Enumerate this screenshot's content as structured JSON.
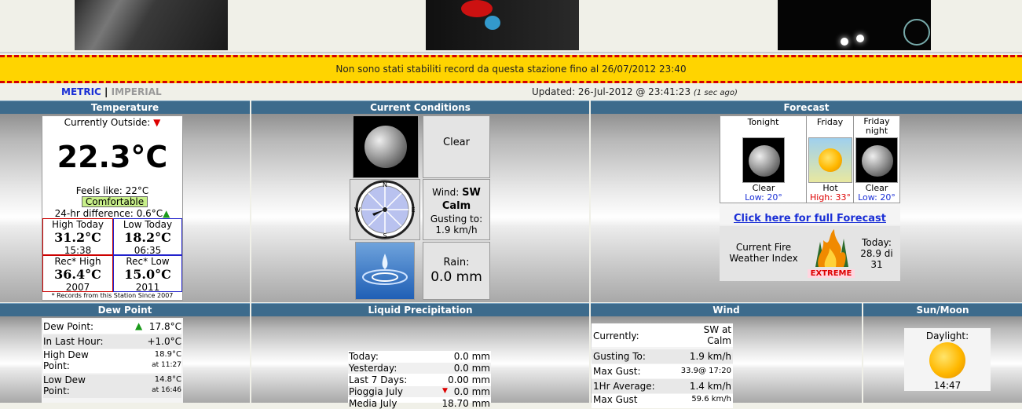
{
  "banner_text": "Non sono stati stabiliti record da questa stazione fino al 26/07/2012 23:40",
  "units": {
    "metric": "METRIC",
    "separator": "|",
    "imperial": "IMPERIAL"
  },
  "updated": {
    "text": "Updated: 26-Jul-2012 @ 23:41:23",
    "ago": "(1 sec ago)"
  },
  "sections": {
    "temperature": "Temperature",
    "current_conditions": "Current Conditions",
    "forecast": "Forecast",
    "dew_point": "Dew Point",
    "liquid_precipitation": "Liquid Precipitation",
    "wind": "Wind",
    "sun_moon": "Sun/Moon"
  },
  "temperature": {
    "currently_label": "Currently Outside:",
    "trend_icon": "arrow-down",
    "value": "22.3°C",
    "feels_like": "Feels like: 22°C",
    "comfort": "Comfortable",
    "diff_label": "24-hr difference:",
    "diff_value": "0.6°C",
    "high_today_label": "High Today",
    "high_today_value": "31.2°C",
    "high_today_time": "15:38",
    "low_today_label": "Low Today",
    "low_today_value": "18.2°C",
    "low_today_time": "06:35",
    "rec_high_label": "Rec* High",
    "rec_high_value": "36.4°C",
    "rec_high_year": "2007",
    "rec_low_label": "Rec* Low",
    "rec_low_value": "15.0°C",
    "rec_low_year": "2011",
    "footnote": "* Records from this Station Since 2007"
  },
  "conditions": {
    "sky": "Clear",
    "wind_label": "Wind:",
    "wind_dir": "SW",
    "wind_speed": "Calm",
    "gust_label": "Gusting to:",
    "gust_value": "1.9 km/h",
    "rain_label": "Rain:",
    "rain_value": "0.0 mm",
    "compass": [
      "N",
      "E",
      "S",
      "W"
    ]
  },
  "forecast": {
    "periods": [
      {
        "name": "Tonight",
        "cond": "Clear",
        "temp": "Low: 20°"
      },
      {
        "name": "Friday",
        "cond": "Hot",
        "temp": "High: 33°"
      },
      {
        "name": "Friday night",
        "cond": "Clear",
        "temp": "Low: 20°"
      }
    ],
    "link": "Click here for full Forecast",
    "fire_label": "Current Fire Weather Index",
    "fire_badge": "EXTREME",
    "fire_today": "Today: 28.9 di 31"
  },
  "dew": [
    {
      "label": "Dew Point:",
      "value": "17.8°C",
      "time": ""
    },
    {
      "label": "In Last Hour:",
      "value": "+1.0°C",
      "time": ""
    },
    {
      "label": "High Dew Point:",
      "value": "18.9°C",
      "time": "at 11:27"
    },
    {
      "label": "Low Dew Point:",
      "value": "14.8°C",
      "time": "at 16:46"
    }
  ],
  "precip": [
    {
      "label": "Today:",
      "value": "0.0 mm"
    },
    {
      "label": "Yesterday:",
      "value": "0.0 mm"
    },
    {
      "label": "Last 7 Days:",
      "value": "0.00 mm"
    },
    {
      "label": "Pioggia July",
      "value": "0.0 mm"
    },
    {
      "label": "Media July",
      "value": "18.70 mm"
    }
  ],
  "wind": [
    {
      "label": "Currently:",
      "value": "SW at Calm"
    },
    {
      "label": "Gusting To:",
      "value": "1.9 km/h"
    },
    {
      "label": "Max Gust:",
      "value": "33.9@ 17:20"
    },
    {
      "label": "1Hr Average:",
      "value": "1.4 km/h"
    },
    {
      "label": "Max Gust",
      "value": "59.6 km/h"
    }
  ],
  "sunmoon": {
    "daylight_label": "Daylight:",
    "daylight_value": "14:47"
  },
  "colors": {
    "header_bg": "#3d6b8c",
    "banner_bg": "#ffd400",
    "banner_border": "#d40000",
    "accent_blue": "#1a2fd6"
  }
}
